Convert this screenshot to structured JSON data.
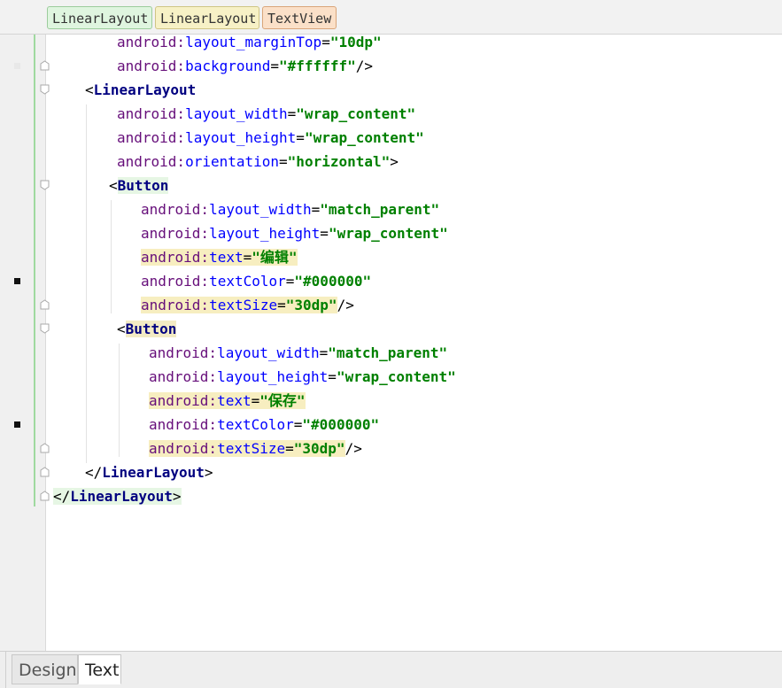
{
  "breadcrumbs": [
    "LinearLayout",
    "LinearLayout",
    "TextView"
  ],
  "tabs": {
    "design": "Design",
    "text": "Text",
    "active": "Text"
  },
  "colors": {
    "attr_name": "#660e7a",
    "attr_value": "#008000",
    "tag": "#000080",
    "highlight": "#f7eec0"
  },
  "code": {
    "l0": {
      "ns": "android:",
      "name": "layout_marginTop",
      "value": "\"10dp\""
    },
    "l1": {
      "ns": "android:",
      "name": "background",
      "value": "\"#ffffff\"",
      "close": "/>"
    },
    "l2": {
      "open": "<",
      "tag": "LinearLayout"
    },
    "l3": {
      "ns": "android:",
      "name": "layout_width",
      "value": "\"wrap_content\""
    },
    "l4": {
      "ns": "android:",
      "name": "layout_height",
      "value": "\"wrap_content\""
    },
    "l5": {
      "ns": "android:",
      "name": "orientation",
      "value": "\"horizontal\"",
      "close": ">"
    },
    "l6": {
      "open": "<",
      "tag": "Button"
    },
    "l7": {
      "ns": "android:",
      "name": "layout_width",
      "value": "\"match_parent\""
    },
    "l8": {
      "ns": "android:",
      "name": "layout_height",
      "value": "\"wrap_content\""
    },
    "l9": {
      "ns": "android:",
      "name": "text",
      "value": "\"编辑\""
    },
    "l10": {
      "ns": "android:",
      "name": "textColor",
      "value": "\"#000000\""
    },
    "l11": {
      "ns": "android:",
      "name": "textSize",
      "value": "\"30dp\"",
      "close": "/>"
    },
    "l12": {
      "open": "<",
      "tag": "Button"
    },
    "l13": {
      "ns": "android:",
      "name": "layout_width",
      "value": "\"match_parent\""
    },
    "l14": {
      "ns": "android:",
      "name": "layout_height",
      "value": "\"wrap_content\""
    },
    "l15": {
      "ns": "android:",
      "name": "text",
      "value": "\"保存\""
    },
    "l16": {
      "ns": "android:",
      "name": "textColor",
      "value": "\"#000000\""
    },
    "l17": {
      "ns": "android:",
      "name": "textSize",
      "value": "\"30dp\"",
      "close": "/>"
    },
    "l18": {
      "open": "</",
      "tag": "LinearLayout",
      "close": ">"
    },
    "l19": {
      "open": "</",
      "tag": "LinearLayout",
      "close": ">"
    }
  }
}
